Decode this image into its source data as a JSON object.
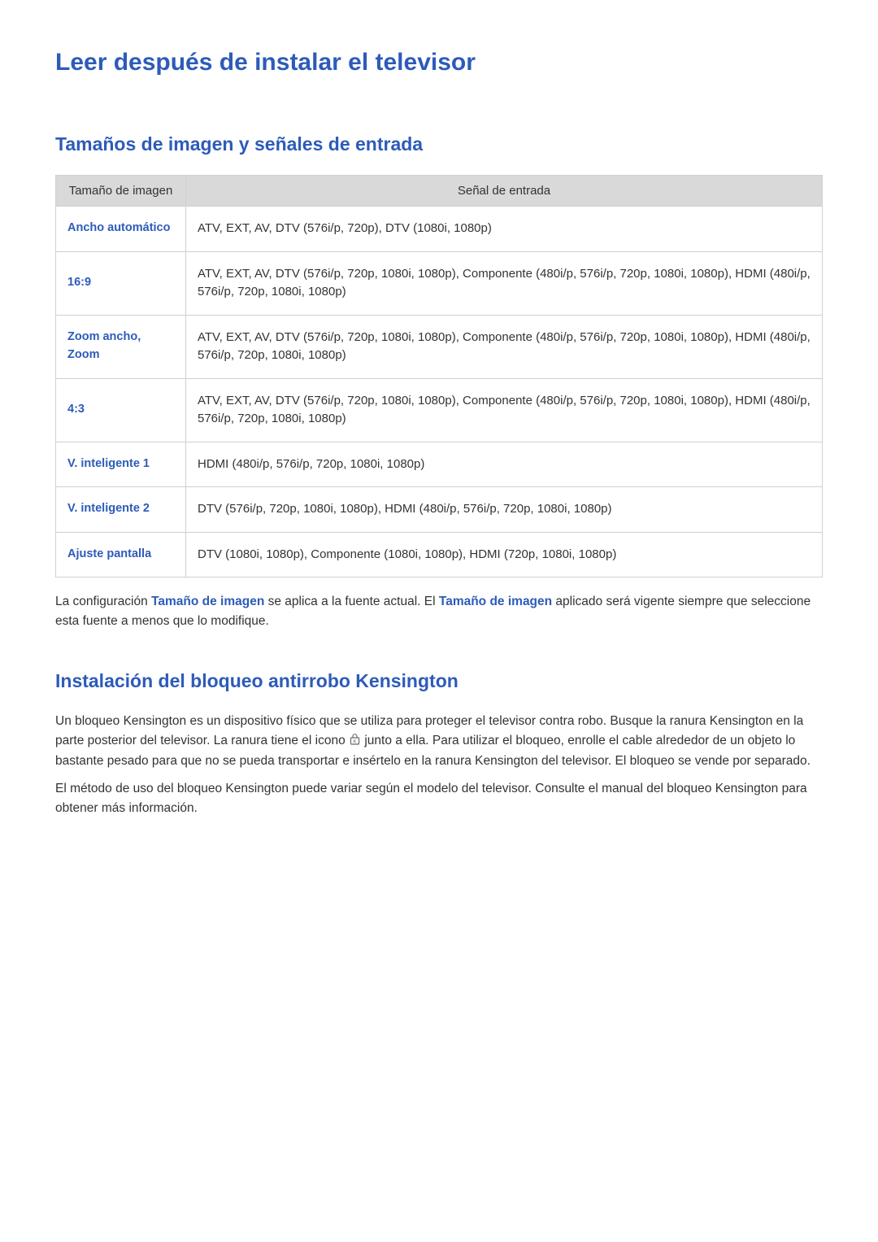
{
  "page": {
    "title": "Leer después de instalar el televisor"
  },
  "section1": {
    "title": "Tamaños de imagen y señales de entrada",
    "table": {
      "header_col1": "Tamaño de imagen",
      "header_col2": "Señal de entrada",
      "rows": [
        {
          "label": "Ancho automático",
          "value": "ATV, EXT, AV, DTV (576i/p, 720p), DTV (1080i, 1080p)"
        },
        {
          "label": "16:9",
          "value": "ATV, EXT, AV, DTV (576i/p, 720p, 1080i, 1080p), Componente (480i/p, 576i/p, 720p, 1080i, 1080p), HDMI (480i/p, 576i/p, 720p, 1080i, 1080p)"
        },
        {
          "label": "Zoom ancho, Zoom",
          "value": "ATV, EXT, AV, DTV (576i/p, 720p, 1080i, 1080p), Componente (480i/p, 576i/p, 720p, 1080i, 1080p), HDMI (480i/p, 576i/p, 720p, 1080i, 1080p)"
        },
        {
          "label": "4:3",
          "value": "ATV, EXT, AV, DTV (576i/p, 720p, 1080i, 1080p), Componente (480i/p, 576i/p, 720p, 1080i, 1080p), HDMI (480i/p, 576i/p, 720p, 1080i, 1080p)"
        },
        {
          "label": "V. inteligente 1",
          "value": "HDMI (480i/p, 576i/p, 720p, 1080i, 1080p)"
        },
        {
          "label": "V. inteligente 2",
          "value": "DTV (576i/p, 720p, 1080i, 1080p), HDMI (480i/p, 576i/p, 720p, 1080i, 1080p)"
        },
        {
          "label": "Ajuste pantalla",
          "value": "DTV (1080i, 1080p), Componente (1080i, 1080p), HDMI (720p, 1080i, 1080p)"
        }
      ]
    },
    "note": {
      "pre": "La configuración ",
      "bold1": "Tamaño de imagen",
      "mid": " se aplica a la fuente actual. El ",
      "bold2": "Tamaño de imagen",
      "post": " aplicado será vigente siempre que seleccione esta fuente a menos que lo modifique."
    }
  },
  "section2": {
    "title": "Instalación del bloqueo antirrobo Kensington",
    "para1": {
      "pre": "Un bloqueo Kensington es un dispositivo físico que se utiliza para proteger el televisor contra robo. Busque la ranura Kensington en la parte posterior del televisor. La ranura tiene el icono ",
      "post": " junto a ella. Para utilizar el bloqueo, enrolle el cable alrededor de un objeto lo bastante pesado para que no se pueda transportar e insértelo en la ranura Kensington del televisor. El bloqueo se vende por separado."
    },
    "para2": "El método de uso del bloqueo Kensington puede variar según el modelo del televisor. Consulte el manual del bloqueo Kensington para obtener más información."
  }
}
